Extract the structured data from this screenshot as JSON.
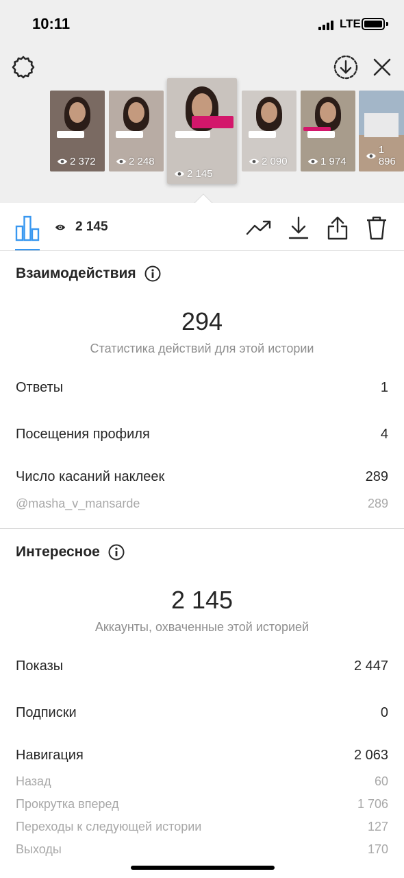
{
  "status_bar": {
    "time": "10:11",
    "network": "LTE"
  },
  "thumbnails": [
    {
      "views": "2 372",
      "bg": "#7a6a62",
      "active": false
    },
    {
      "views": "2 248",
      "bg": "#b8aca4",
      "active": false
    },
    {
      "views": "2 145",
      "bg": "#c9c3be",
      "active": true
    },
    {
      "views": "2 090",
      "bg": "#cfcac6",
      "active": false
    },
    {
      "views": "1 974",
      "bg": "#a89c8c",
      "active": false
    },
    {
      "views": "1 896",
      "bg": "#a3b6c8",
      "active": false
    }
  ],
  "toolbar": {
    "view_count": "2 145"
  },
  "interactions": {
    "title": "Взаимодействия",
    "total": "294",
    "caption": "Статистика действий для этой истории",
    "rows": [
      {
        "label": "Ответы",
        "value": "1"
      },
      {
        "label": "Посещения профиля",
        "value": "4"
      },
      {
        "label": "Число касаний наклеек",
        "value": "289"
      }
    ],
    "sub_rows": [
      {
        "label": "@masha_v_mansarde",
        "value": "289"
      }
    ]
  },
  "discovery": {
    "title": "Интересное",
    "total": "2 145",
    "caption": "Аккаунты, охваченные этой историей",
    "rows": [
      {
        "label": "Показы",
        "value": "2 447"
      },
      {
        "label": "Подписки",
        "value": "0"
      },
      {
        "label": "Навигация",
        "value": "2 063"
      }
    ],
    "sub_rows": [
      {
        "label": "Назад",
        "value": "60"
      },
      {
        "label": "Прокрутка вперед",
        "value": "1 706"
      },
      {
        "label": "Переходы к следующей истории",
        "value": "127"
      },
      {
        "label": "Выходы",
        "value": "170"
      }
    ]
  },
  "colors": {
    "accent": "#3897f0",
    "text": "#262626",
    "muted": "#8e8e8e",
    "top_bg": "#efefef"
  }
}
